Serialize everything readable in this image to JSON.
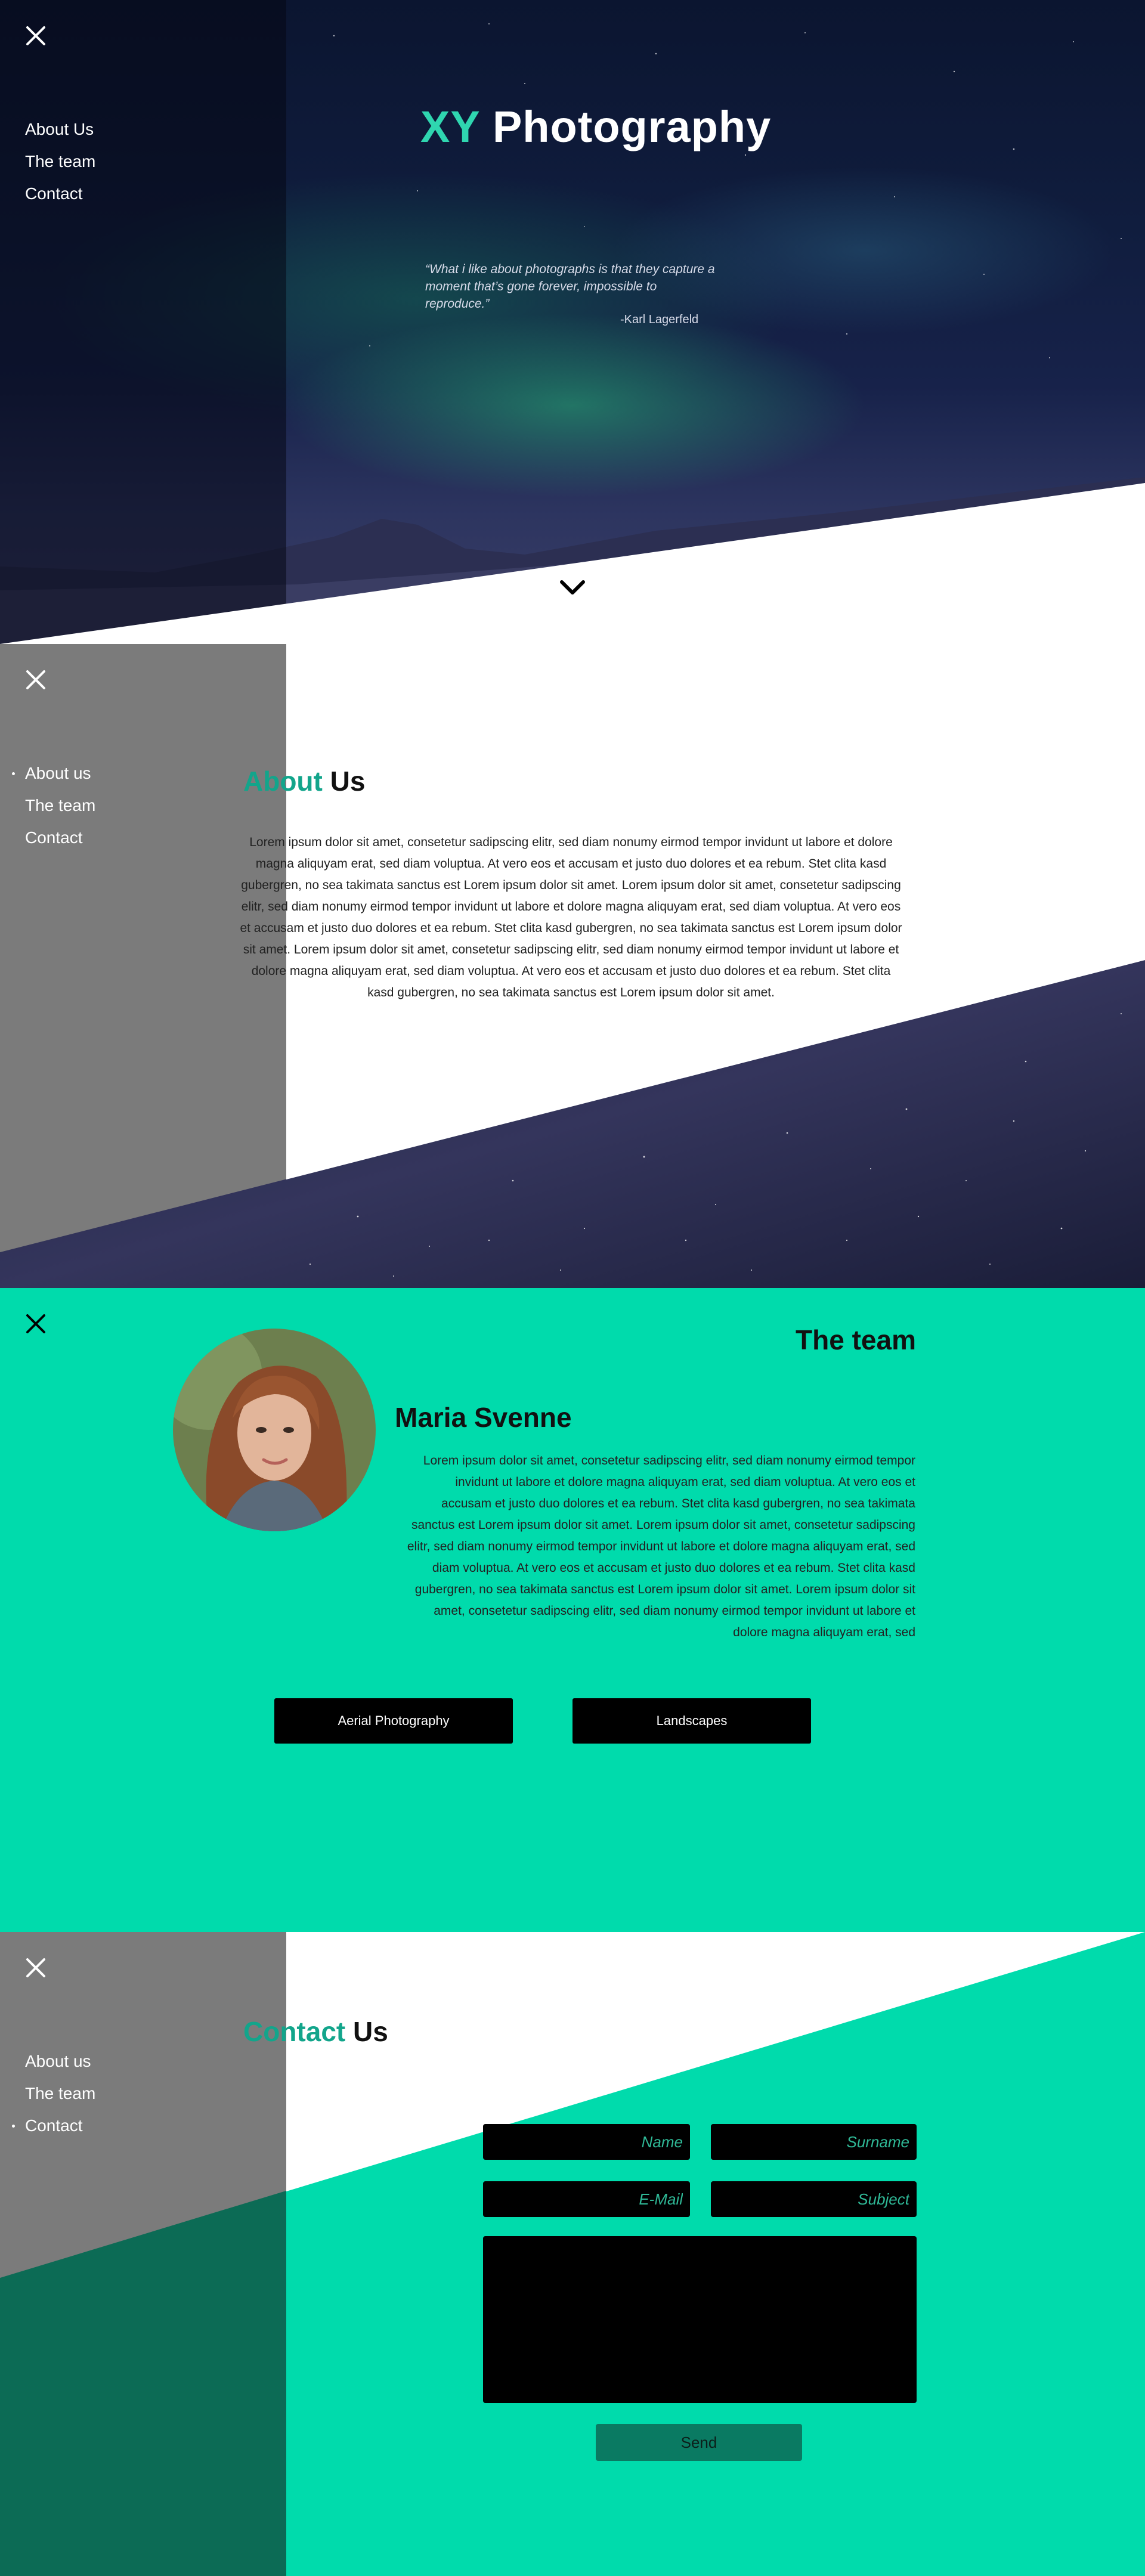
{
  "nav": {
    "items": [
      {
        "label": "About Us"
      },
      {
        "label": "The team"
      },
      {
        "label": "Contact"
      }
    ],
    "items_lower": [
      {
        "label": "About us"
      },
      {
        "label": "The team"
      },
      {
        "label": "Contact"
      }
    ]
  },
  "hero": {
    "brand_accent": "XY",
    "brand_rest": " Photography",
    "quote": "“What i like about photographs is that they capture a moment that’s gone forever, impossible to reproduce.”",
    "quote_author": "-Karl Lagerfeld"
  },
  "about": {
    "title_accent": "About",
    "title_rest": " Us",
    "body": "Lorem ipsum dolor sit amet, consetetur sadipscing elitr, sed diam nonumy eirmod tempor invidunt ut labore et dolore magna aliquyam erat, sed diam voluptua. At vero eos et accusam et justo duo dolores et ea rebum. Stet clita kasd gubergren, no sea takimata sanctus est Lorem ipsum dolor sit amet. Lorem ipsum dolor sit amet, consetetur sadipscing elitr, sed diam nonumy eirmod tempor invidunt ut labore et dolore magna aliquyam erat, sed diam voluptua. At vero eos et accusam et justo duo dolores et ea rebum. Stet clita kasd gubergren, no sea takimata sanctus est Lorem ipsum dolor sit amet. Lorem ipsum dolor sit amet, consetetur sadipscing elitr, sed diam nonumy eirmod tempor invidunt ut labore et dolore magna aliquyam erat, sed diam voluptua. At vero eos et accusam et justo duo dolores et ea rebum. Stet clita kasd gubergren, no sea takimata sanctus est Lorem ipsum dolor sit amet."
  },
  "team": {
    "title": "The team",
    "member_name": "Maria Svenne",
    "member_bio": "Lorem ipsum dolor sit amet, consetetur sadipscing elitr, sed diam nonumy eirmod tempor invidunt ut labore et dolore magna aliquyam erat, sed diam voluptua. At vero eos et accusam et justo duo dolores et ea rebum. Stet clita kasd gubergren, no sea takimata sanctus est Lorem ipsum dolor sit amet. Lorem ipsum dolor sit amet, consetetur sadipscing elitr, sed diam nonumy eirmod tempor invidunt ut labore et dolore magna aliquyam erat, sed diam voluptua. At vero eos et accusam et justo duo dolores et ea rebum. Stet clita kasd gubergren, no sea takimata sanctus est Lorem ipsum dolor sit amet. Lorem ipsum dolor sit amet, consetetur sadipscing elitr, sed diam nonumy eirmod tempor invidunt ut labore et dolore magna aliquyam erat, sed",
    "buttons": [
      {
        "label": "Aerial Photography"
      },
      {
        "label": "Landscapes"
      }
    ]
  },
  "contact": {
    "title_accent": "Contact",
    "title_rest": " Us",
    "name_placeholder": "Name",
    "surname_placeholder": "Surname",
    "email_placeholder": "E-Mail",
    "subject_placeholder": "Subject",
    "send_label": "Send"
  },
  "colors": {
    "accent": "#00dbac",
    "accent_text": "#12a58b",
    "send_button": "#0a7a62"
  },
  "icons": [
    "close-icon",
    "chevron-down-icon"
  ]
}
